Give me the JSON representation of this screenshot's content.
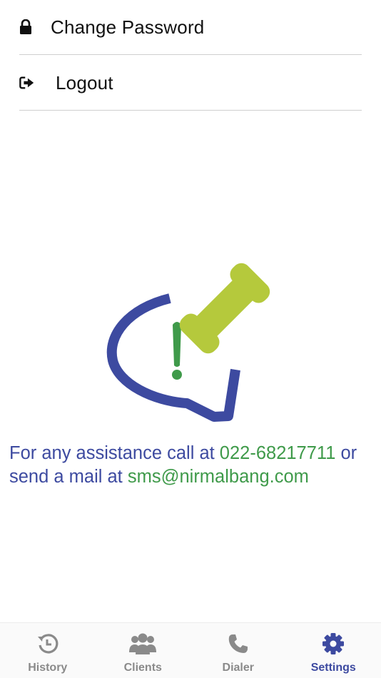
{
  "menu": {
    "items": [
      {
        "label": "Change Password",
        "icon": "lock-icon"
      },
      {
        "label": "Logout",
        "icon": "logout-icon"
      }
    ]
  },
  "support": {
    "line1_prefix": "For any assistance call at ",
    "phone": "022-68217711",
    "line1_suffix": " or",
    "line2_prefix": "send a mail at ",
    "email": "sms@nirmalbang.com"
  },
  "colors": {
    "brand_blue": "#3d4aa0",
    "brand_green": "#3f9a4a",
    "logo_lime": "#b5c93c",
    "inactive_gray": "#8a8a8a"
  },
  "tabbar": {
    "active": "Settings",
    "tabs": [
      {
        "label": "History",
        "icon": "history-icon"
      },
      {
        "label": "Clients",
        "icon": "clients-icon"
      },
      {
        "label": "Dialer",
        "icon": "phone-icon"
      },
      {
        "label": "Settings",
        "icon": "gear-icon"
      }
    ]
  }
}
